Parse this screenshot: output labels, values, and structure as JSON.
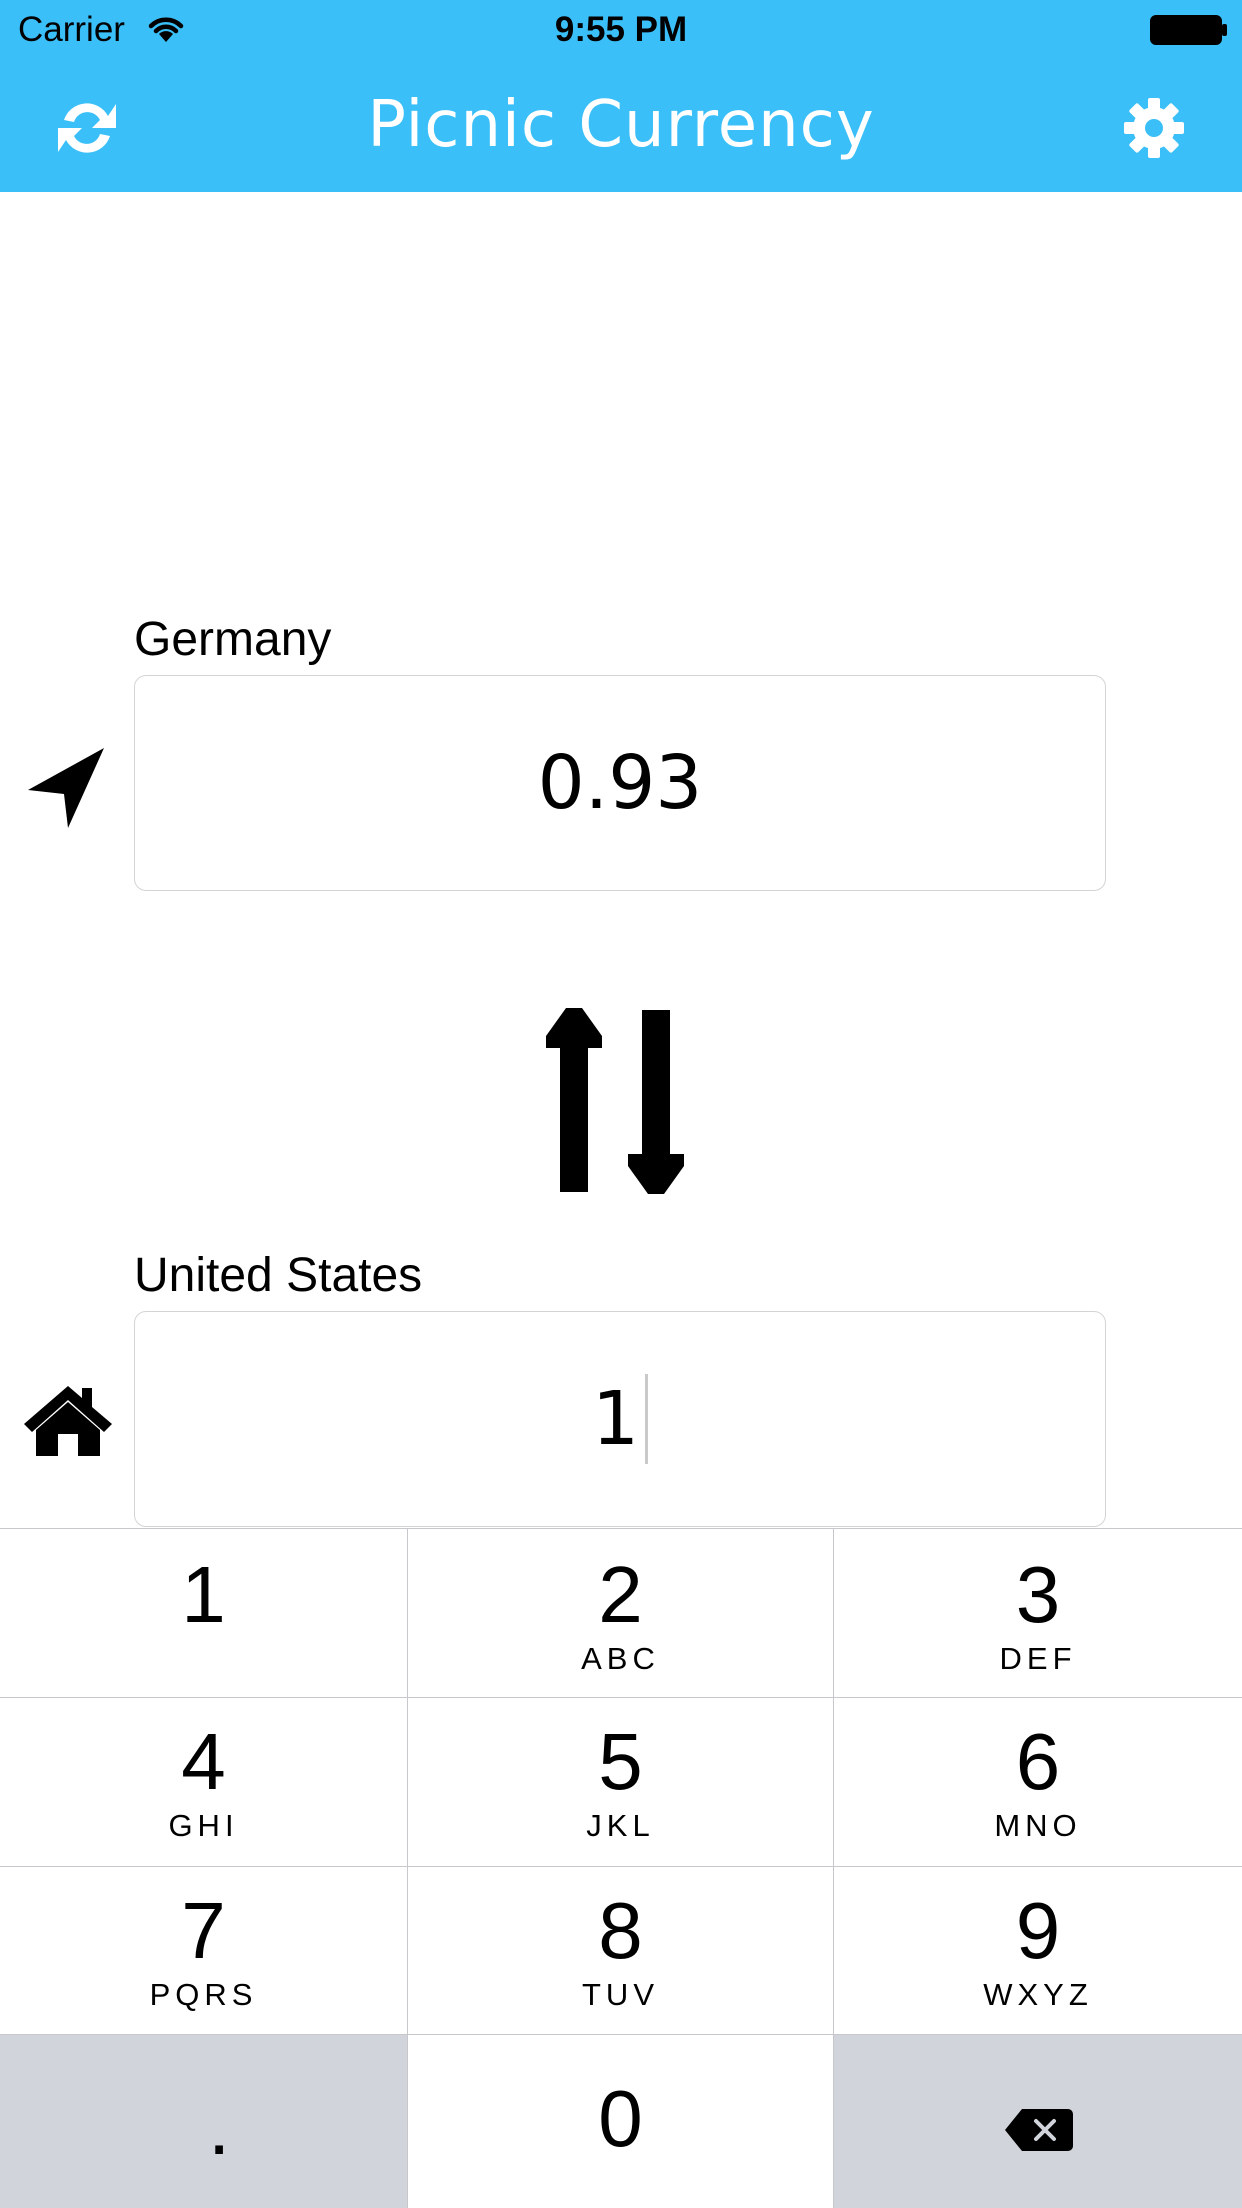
{
  "status_bar": {
    "carrier": "Carrier",
    "time": "9:55 PM"
  },
  "header": {
    "title": "Picnic Currency",
    "background_color": "#3bbff8",
    "left_icon": "refresh-icon",
    "right_icon": "gear-icon"
  },
  "from_currency": {
    "country": "Germany",
    "amount": "0.93",
    "icon": "location-arrow-icon"
  },
  "swap": {
    "icon": "swap-arrows-icon"
  },
  "to_currency": {
    "country": "United States",
    "amount": "1",
    "icon": "home-icon"
  },
  "keypad": {
    "keys": [
      {
        "digit": "1",
        "letters": ""
      },
      {
        "digit": "2",
        "letters": "ABC"
      },
      {
        "digit": "3",
        "letters": "DEF"
      },
      {
        "digit": "4",
        "letters": "GHI"
      },
      {
        "digit": "5",
        "letters": "JKL"
      },
      {
        "digit": "6",
        "letters": "MNO"
      },
      {
        "digit": "7",
        "letters": "PQRS"
      },
      {
        "digit": "8",
        "letters": "TUV"
      },
      {
        "digit": "9",
        "letters": "WXYZ"
      }
    ],
    "decimal": ".",
    "zero": "0",
    "backspace_icon": "backspace-icon"
  }
}
